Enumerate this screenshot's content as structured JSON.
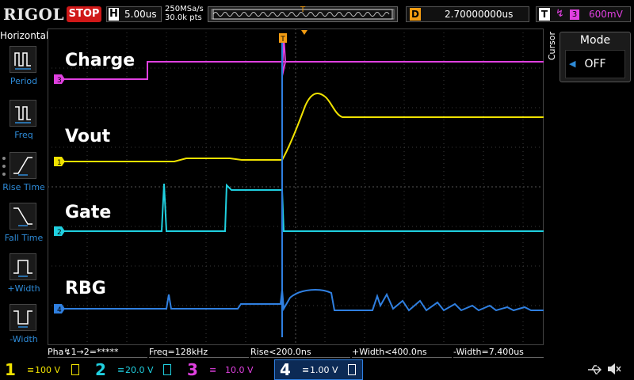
{
  "brand": "RIGOL",
  "run_state": "STOP",
  "horizontal": {
    "label": "H",
    "timebase": "5.00us",
    "sample_rate": "250MSa/s",
    "memory_depth": "30.0k pts"
  },
  "delay": {
    "label": "D",
    "value": "2.70000000us"
  },
  "trigger": {
    "label": "T",
    "source": "3",
    "level": "600mV",
    "edge_icon": "rising-edge-icon"
  },
  "menu": {
    "title": "Horizontal",
    "items": [
      {
        "label": "Period",
        "icon": "period-icon"
      },
      {
        "label": "Freq",
        "icon": "freq-icon"
      },
      {
        "label": "Rise Time",
        "icon": "rise-time-icon"
      },
      {
        "label": "Fall Time",
        "icon": "fall-time-icon"
      },
      {
        "label": "+Width",
        "icon": "plus-width-icon"
      },
      {
        "label": "-Width",
        "icon": "minus-width-icon"
      }
    ]
  },
  "trace_labels": {
    "charge": "Charge",
    "vout": "Vout",
    "gate": "Gate",
    "rbg": "RBG"
  },
  "channel_markers": {
    "ch3": "3",
    "ch1": "1",
    "ch2": "2",
    "ch4": "4"
  },
  "cursor": {
    "side_label": "Cursor",
    "mode_title": "Mode",
    "mode_value": "OFF"
  },
  "measurements": [
    "Pha↯1→2=*****",
    "Freq=128kHz",
    "Rise<200.0ns",
    "+Width<400.0ns",
    "-Width=7.400us"
  ],
  "channels": [
    {
      "num": "1",
      "scale": "100 V",
      "color": "#f0e200"
    },
    {
      "num": "2",
      "scale": "20.0 V",
      "color": "#20d0e0"
    },
    {
      "num": "3",
      "scale": "10.0 V",
      "color": "#e040e0"
    },
    {
      "num": "4",
      "scale": "1.00 V",
      "color": "#2f7fe0"
    }
  ],
  "colors": {
    "ch1": "#f0e200",
    "ch2": "#20d0e0",
    "ch3": "#e040e0",
    "ch4": "#2f7fe0",
    "accent": "#f39c12",
    "stop": "#d01818"
  }
}
